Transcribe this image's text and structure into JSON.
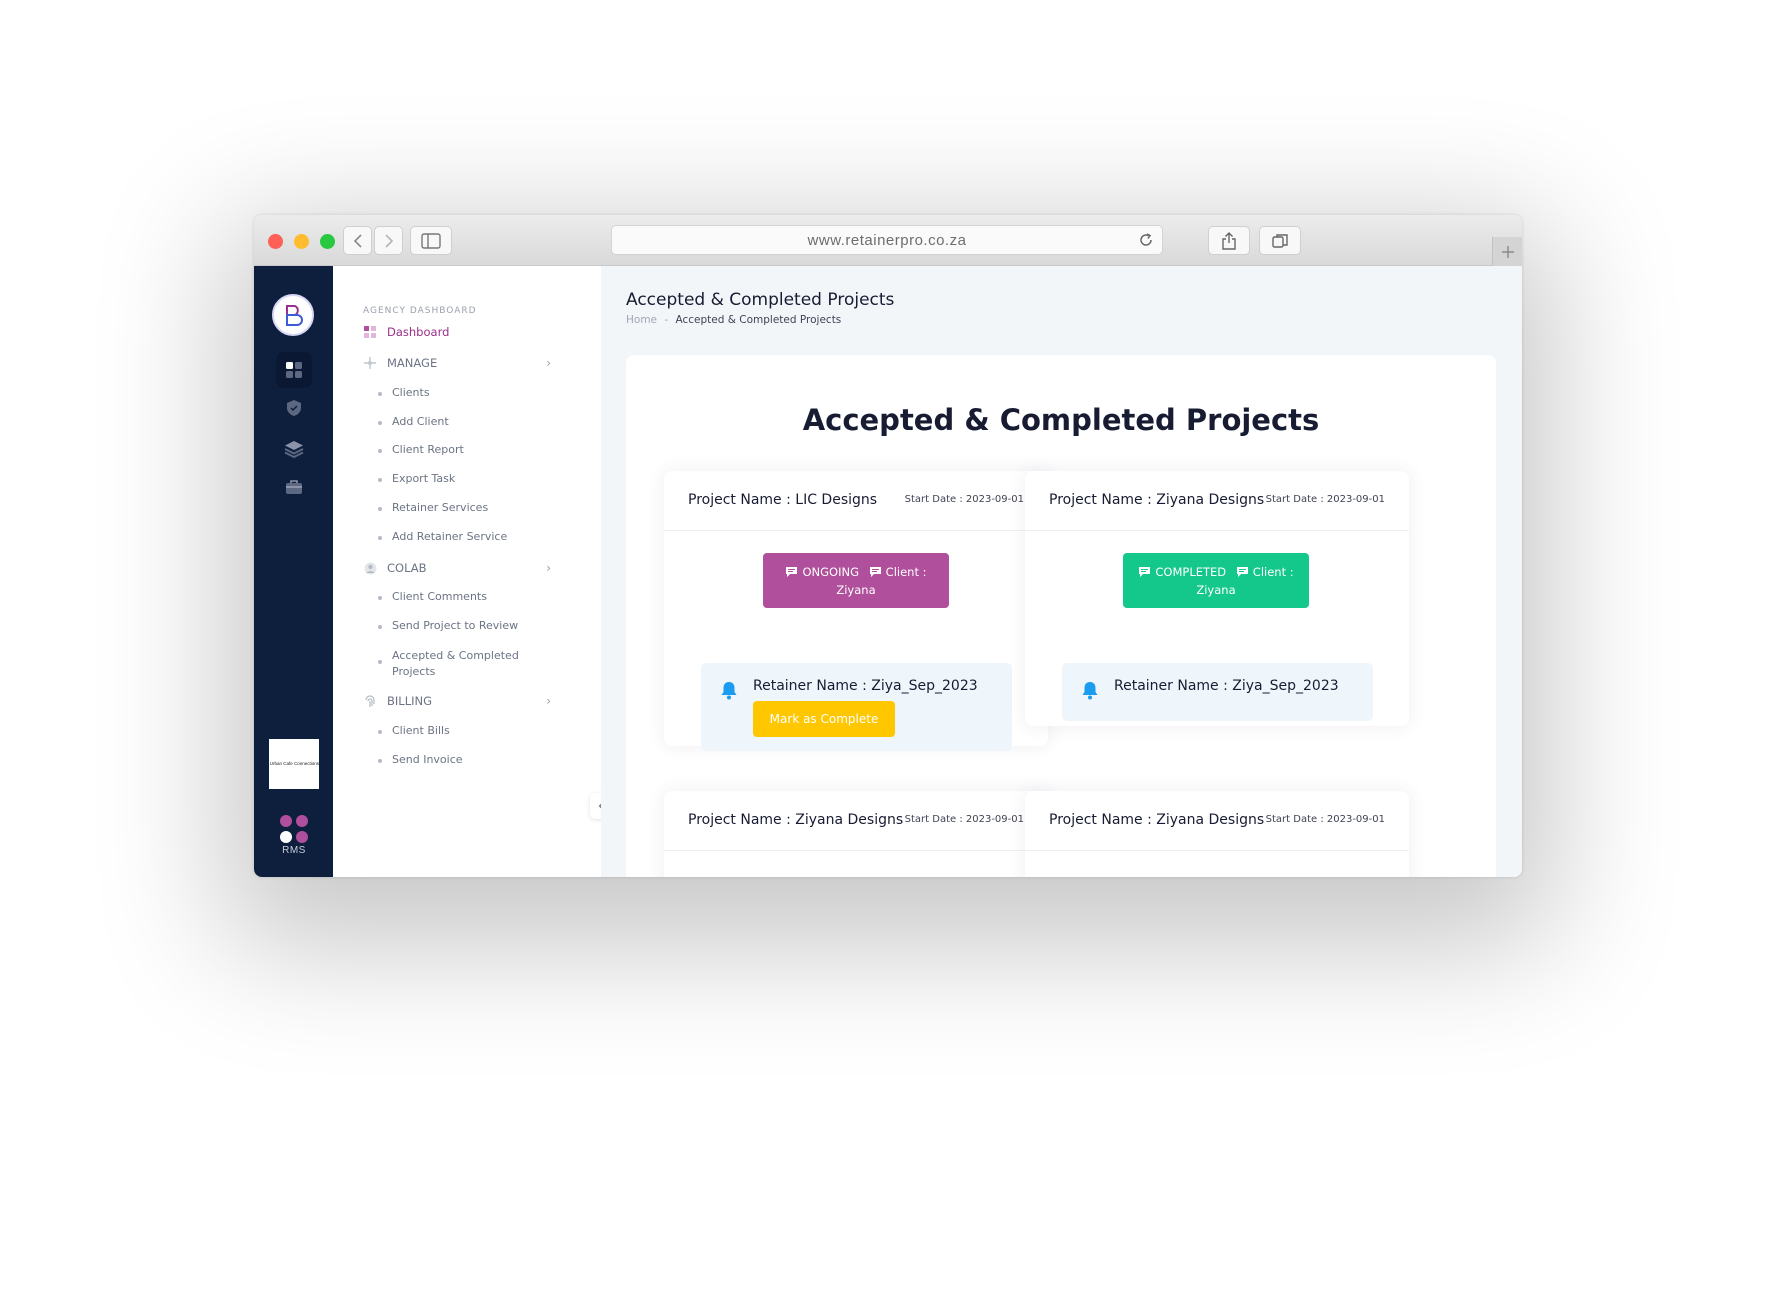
{
  "browser": {
    "url": "www.retainerpro.co.za"
  },
  "rail": {
    "brand_text": "Urban Cafe Connections",
    "rms_label": "RMS",
    "colors": {
      "background": "#0e1f3e",
      "rms_dots": [
        "#b04f9b",
        "#b04f9b",
        "#ffffff",
        "#b04f9b"
      ]
    }
  },
  "menu": {
    "heading": "AGENCY DASHBOARD",
    "dashboard": "Dashboard",
    "manage": {
      "label": "MANAGE",
      "items": [
        "Clients",
        "Add Client",
        "Client Report",
        "Export Task",
        "Retainer Services",
        "Add Retainer Service"
      ]
    },
    "colab": {
      "label": "COLAB",
      "items": [
        "Client Comments",
        "Send Project to Review",
        "Accepted & Completed",
        "Projects"
      ]
    },
    "billing": {
      "label": "BILLING",
      "items": [
        "Client Bills",
        "Send Invoice"
      ]
    }
  },
  "main": {
    "page_title": "Accepted & Completed Projects",
    "breadcrumb": {
      "home": "Home",
      "separator": "-",
      "current": "Accepted & Completed Projects"
    },
    "panel_title": "Accepted & Completed Projects",
    "cards": [
      {
        "project": "Project Name : LIC Designs",
        "start": "Start Date : 2023-09-01",
        "status": "ONGOING",
        "client_label": "Client :",
        "client": "Ziyana",
        "status_color": "#b04f9b",
        "retainer": "Retainer Name : Ziya_Sep_2023",
        "action": "Mark as Complete"
      },
      {
        "project": "Project Name : Ziyana Designs",
        "start": "Start Date : 2023-09-01",
        "status": "COMPLETED",
        "client_label": "Client :",
        "client": "Ziyana",
        "status_color": "#14c78a",
        "retainer": "Retainer Name : Ziya_Sep_2023"
      },
      {
        "project": "Project Name : Ziyana Designs",
        "start": "Start Date : 2023-09-01"
      },
      {
        "project": "Project Name : Ziyana Designs",
        "start": "Start Date : 2023-09-01"
      }
    ],
    "colors": {
      "accent": "#9b2f8a",
      "action": "#ffc700",
      "bell": "#1b9cf0"
    }
  }
}
